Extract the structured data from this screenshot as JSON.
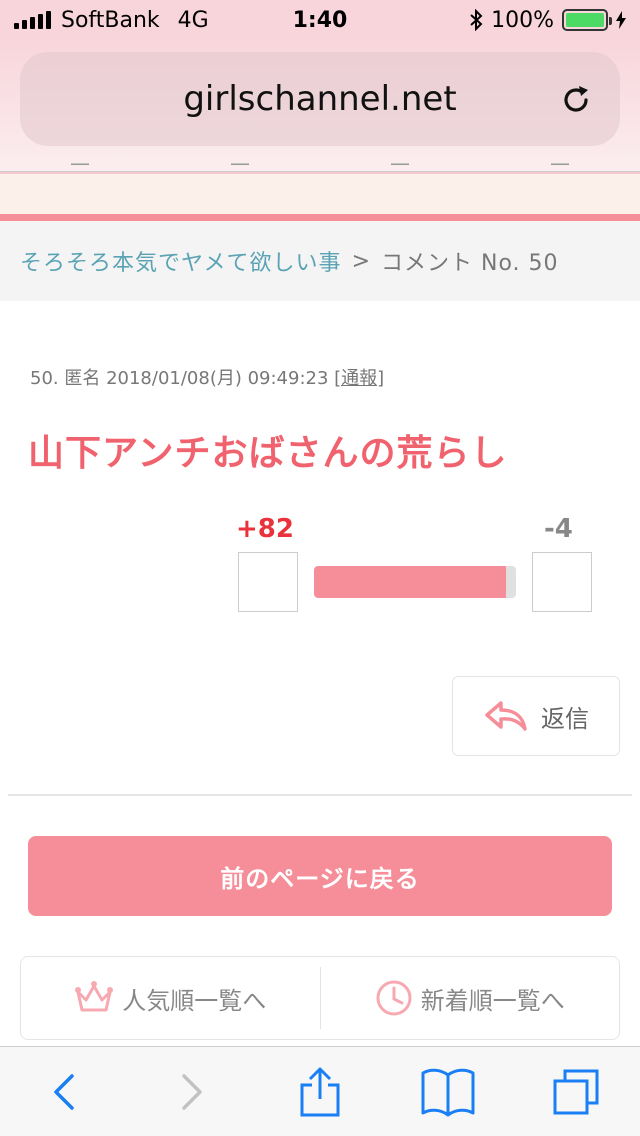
{
  "status_bar": {
    "carrier": "SoftBank",
    "network": "4G",
    "time": "1:40",
    "battery": "100%",
    "battery_level": 1.0
  },
  "browser": {
    "url": "girlschannel.net"
  },
  "breadcrumb": {
    "topic": "そろそろ本気でヤメて欲しい事",
    "separator": ">",
    "current": "コメント No. 50"
  },
  "comment": {
    "meta": "50. 匿名 2018/01/08(月) 09:49:23 ",
    "report_label": "[通報]",
    "body": "山下アンチおばさんの荒らし",
    "plus": "+82",
    "minus": "-4",
    "plus_ratio": 0.95
  },
  "reply_label": "返信",
  "back_button_label": "前のページに戻る",
  "rank_nav": {
    "popular": "人気順一覧へ",
    "newest": "新着順一覧へ"
  },
  "colors": {
    "accent": "#f58e98",
    "title_red": "#f0626d",
    "plus_red": "#e9323b",
    "link_blue": "#5aa3b5",
    "ios_blue": "#1a7ef5"
  },
  "icons": {
    "reload": "reload-icon",
    "reply": "reply-arrow-icon",
    "crown": "crown-icon",
    "clock": "clock-icon",
    "back": "chevron-left-icon",
    "forward": "chevron-right-icon",
    "share": "share-icon",
    "bookmarks": "book-icon",
    "tabs": "tabs-icon"
  }
}
